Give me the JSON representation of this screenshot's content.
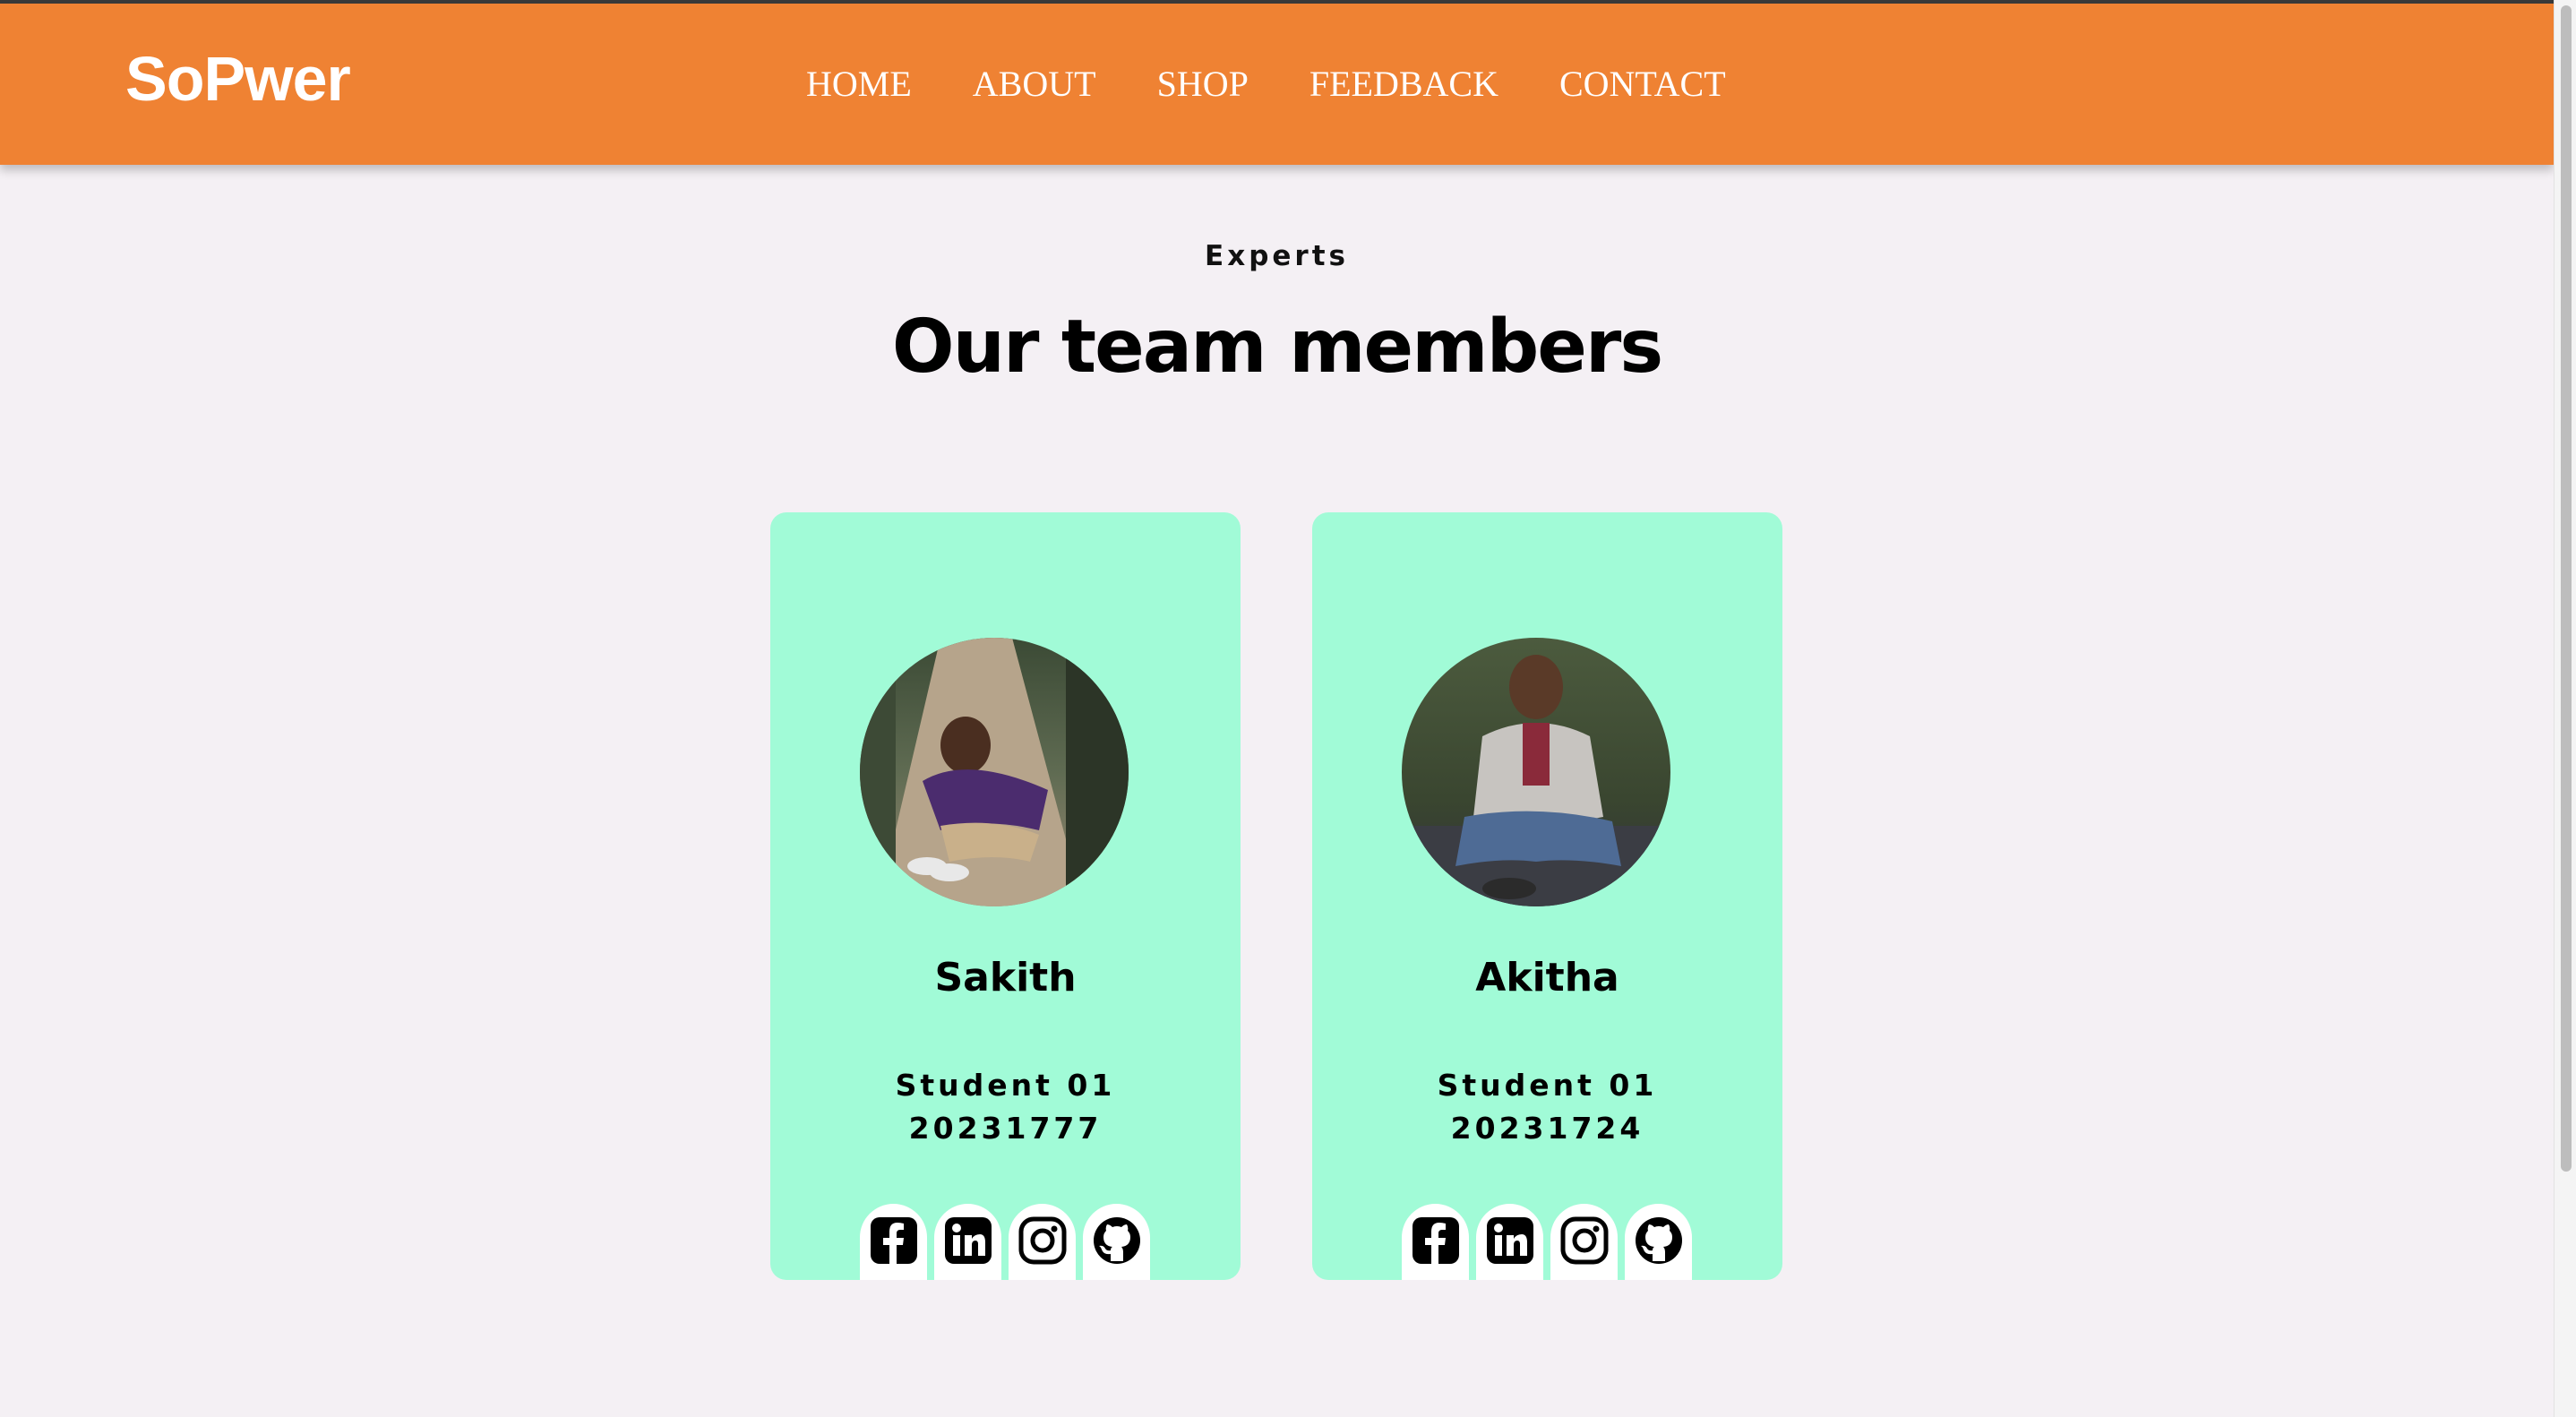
{
  "header": {
    "brand": "SoPwer",
    "nav": [
      {
        "label": "HOME"
      },
      {
        "label": "ABOUT"
      },
      {
        "label": "SHOP"
      },
      {
        "label": "FEEDBACK"
      },
      {
        "label": "CONTACT"
      }
    ]
  },
  "section": {
    "eyebrow": "Experts",
    "heading": "Our team members"
  },
  "members": [
    {
      "name": "Sakith",
      "role": "Student 01",
      "student_id": "20231777",
      "socials": [
        "facebook-icon",
        "linkedin-icon",
        "instagram-icon",
        "github-icon"
      ]
    },
    {
      "name": "Akitha",
      "role": "Student 01",
      "student_id": "20231724",
      "socials": [
        "facebook-icon",
        "linkedin-icon",
        "instagram-icon",
        "github-icon"
      ]
    }
  ],
  "colors": {
    "header": "#ef8233",
    "card": "#a1fbd7",
    "page_background": "#f4f0f4"
  }
}
